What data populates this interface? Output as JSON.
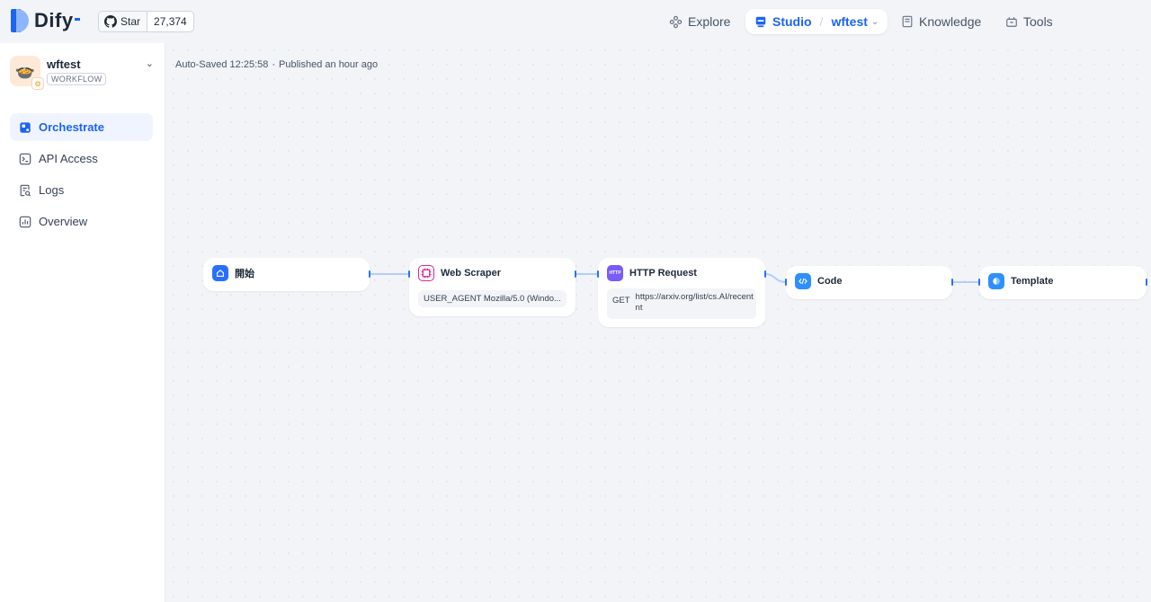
{
  "brand": {
    "name": "Dify"
  },
  "github": {
    "star_label": "Star",
    "count": "27,374"
  },
  "nav": {
    "explore": "Explore",
    "studio": "Studio",
    "current_app": "wftest",
    "knowledge": "Knowledge",
    "tools": "Tools"
  },
  "app": {
    "name": "wftest",
    "type": "WORKFLOW"
  },
  "sidebar": {
    "items": [
      {
        "label": "Orchestrate",
        "icon": "orchestrate-icon",
        "active": true
      },
      {
        "label": "API Access",
        "icon": "terminal-icon",
        "active": false
      },
      {
        "label": "Logs",
        "icon": "logs-icon",
        "active": false
      },
      {
        "label": "Overview",
        "icon": "chart-icon",
        "active": false
      }
    ]
  },
  "status": {
    "saved": "Auto-Saved 12:25:58",
    "published": "Published an hour ago"
  },
  "nodes": {
    "start": {
      "title": "開始"
    },
    "web_scraper": {
      "title": "Web Scraper",
      "detail_key": "USER_AGENT",
      "detail_value": "Mozilla/5.0 (Windo..."
    },
    "http": {
      "title": "HTTP Request",
      "method": "GET",
      "url_line1": "https://arxiv.org/list/cs.AI/recent",
      "url_line2": "nt",
      "icon_text": "HTTP"
    },
    "code": {
      "title": "Code"
    },
    "template": {
      "title": "Template"
    }
  },
  "colors": {
    "accent": "#1c64f2",
    "edge": "#b2ccff",
    "start_icon": "#2970ff",
    "scraper_icon": "#dd2590",
    "http_icon": "#7a5af8",
    "code_icon": "#2e90fa",
    "template_icon": "#2e90fa"
  }
}
